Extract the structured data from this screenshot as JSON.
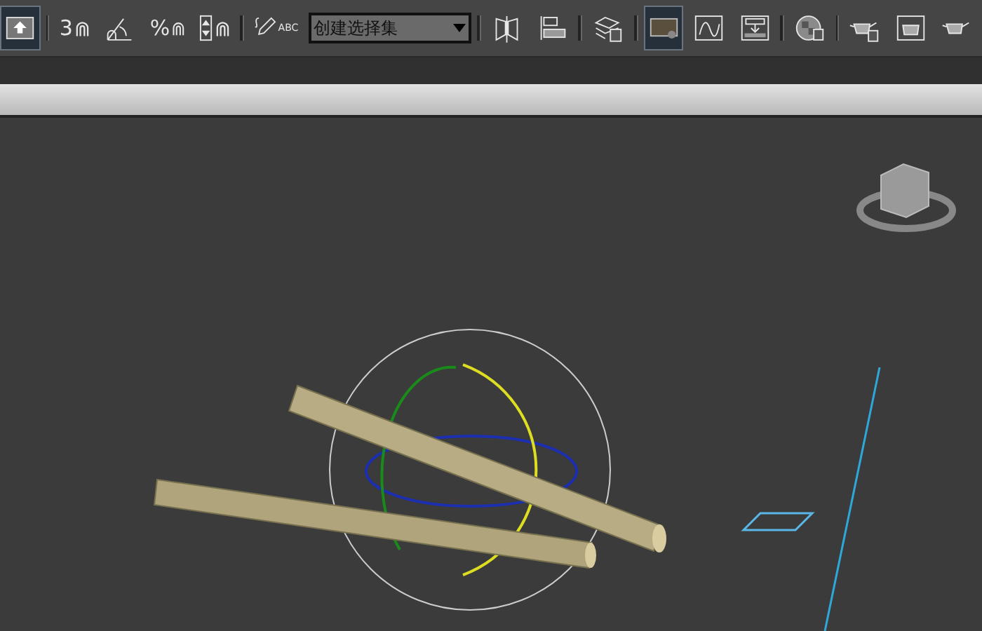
{
  "toolbar": {
    "buttons": [
      {
        "selected": true
      },
      {
        "label": "3",
        "selected": false
      },
      {
        "selected": false
      },
      {
        "label": "%",
        "selected": false
      },
      {
        "selected": false
      },
      {
        "label": "ABC",
        "selected": false
      },
      {
        "selected": false
      },
      {
        "selected": false
      },
      {
        "selected": false
      },
      {
        "selected": true
      },
      {
        "selected": false
      },
      {
        "selected": false
      },
      {
        "selected": false
      },
      {
        "selected": false
      },
      {
        "selected": false
      },
      {
        "selected": false
      }
    ],
    "selection_set": {
      "value": "创建选择集"
    }
  }
}
